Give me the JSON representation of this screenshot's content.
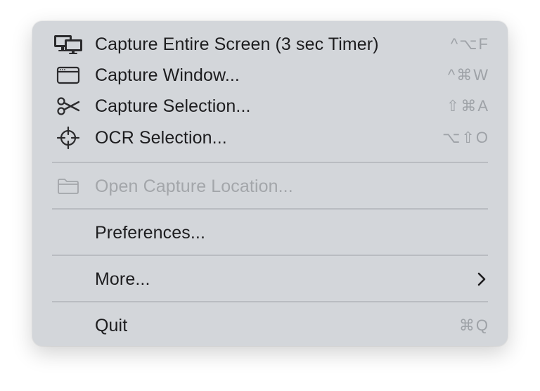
{
  "menu": {
    "items": [
      {
        "label": "Capture Entire Screen (3 sec Timer)",
        "shortcut": "^⌥F",
        "icon": "display-icon"
      },
      {
        "label": "Capture Window...",
        "shortcut": "^⌘W",
        "icon": "window-icon"
      },
      {
        "label": "Capture Selection...",
        "shortcut": "⇧⌘A",
        "icon": "scissors-icon"
      },
      {
        "label": "OCR Selection...",
        "shortcut": "⌥⇧O",
        "icon": "crosshair-icon"
      },
      {
        "label": "Open Capture Location...",
        "icon": "folder-icon",
        "disabled": true
      },
      {
        "label": "Preferences..."
      },
      {
        "label": "More...",
        "submenu": true,
        "icon": "chevron-right-icon"
      },
      {
        "label": "Quit",
        "shortcut": "⌘Q"
      }
    ]
  },
  "colors": {
    "menu_background": "#d3d6da",
    "text": "#1d1d1f",
    "disabled_text": "#a3a6aa",
    "shortcut_text": "#9ea2a7",
    "separator": "#b9bcc1"
  }
}
